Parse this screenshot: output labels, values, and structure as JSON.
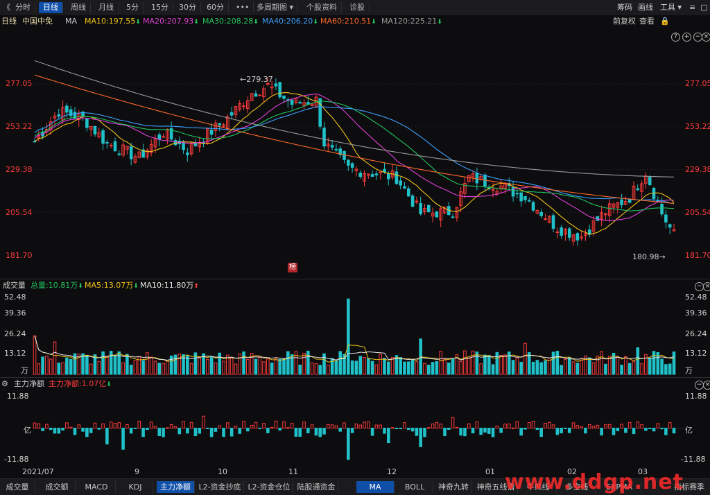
{
  "toolbar": {
    "back_icon": "chevron-left-icon",
    "tabs": [
      "分时",
      "日线",
      "周线",
      "月线",
      "5分",
      "15分",
      "30分",
      "60分",
      "•••",
      "多周期图",
      "个股资料",
      "诊股"
    ],
    "active_tab": "日线",
    "right_items": [
      "筹码",
      "画线",
      "工具"
    ]
  },
  "ma_row": {
    "period": "日线",
    "stock_name": "中国中免",
    "ma_label": "MA",
    "ma10": "MA10:197.55",
    "ma20": "MA20:207.93",
    "ma30": "MA30:208.28",
    "ma40": "MA40:206.20",
    "ma60": "MA60:210.51",
    "ma120": "MA120:225.21",
    "right_a": "前复权",
    "right_b": "查看"
  },
  "price_axis": {
    "labels": [
      "277.05",
      "253.22",
      "229.38",
      "205.54",
      "181.70"
    ]
  },
  "annotations": {
    "high": "←279.37",
    "low": "180.98→",
    "badge": "榜"
  },
  "volume_pane": {
    "title": "成交量",
    "total": "总量:10.81万",
    "ma5": "MA5:13.07万",
    "ma10": "MA10:11.80万",
    "axis": [
      "52.48",
      "39.36",
      "26.24",
      "13.12",
      "万"
    ]
  },
  "flow_pane": {
    "title": "主力净额",
    "value": "主力净额:1.07亿",
    "axis": [
      "11.88",
      "亿",
      "-11.88"
    ]
  },
  "x_axis": {
    "labels": [
      "2021/07",
      "9",
      "10",
      "11",
      "12",
      "01",
      "02",
      "03"
    ]
  },
  "bottom_tabs": {
    "left": [
      "成交量",
      "成交额",
      "MACD",
      "KDJ",
      "主力净额",
      "L2-资金抄底",
      "L2-资金仓位",
      "陆股通资金"
    ],
    "right": [
      "MA",
      "BOLL",
      "神奇九转",
      "神奇五线谱",
      "牛熊线",
      "多空线",
      "EXPMA",
      "指标赛季"
    ],
    "active_left": "主力净额",
    "active_right": "MA"
  },
  "watermark": "www.ddgp.net",
  "colors": {
    "up": "#ff3b3b",
    "down": "#20c1c9",
    "ma10": "#f2c318",
    "ma20": "#e040d8",
    "ma30": "#22c55e",
    "ma40": "#3aa0ff",
    "ma60": "#ff6a2a",
    "ma120": "#9a9a9a",
    "active": "#0f4fa8"
  },
  "chart_data": {
    "type": "candlestick",
    "ylim": [
      181.7,
      277.05
    ],
    "price_high": 279.37,
    "price_low": 180.98,
    "x_ticks": [
      "2021/07",
      "9",
      "10",
      "11",
      "12",
      "01",
      "02",
      "03"
    ],
    "ma_last": {
      "MA10": 197.55,
      "MA20": 207.93,
      "MA30": 208.28,
      "MA40": 206.2,
      "MA60": 210.51,
      "MA120": 225.21
    },
    "volume_last": {
      "total": "10.81万",
      "MA5": "13.07万",
      "MA10": "11.80万"
    },
    "volume_ylim": [
      0,
      52.48
    ],
    "flow_last": "1.07亿",
    "flow_ylim": [
      -11.88,
      11.88
    ]
  }
}
